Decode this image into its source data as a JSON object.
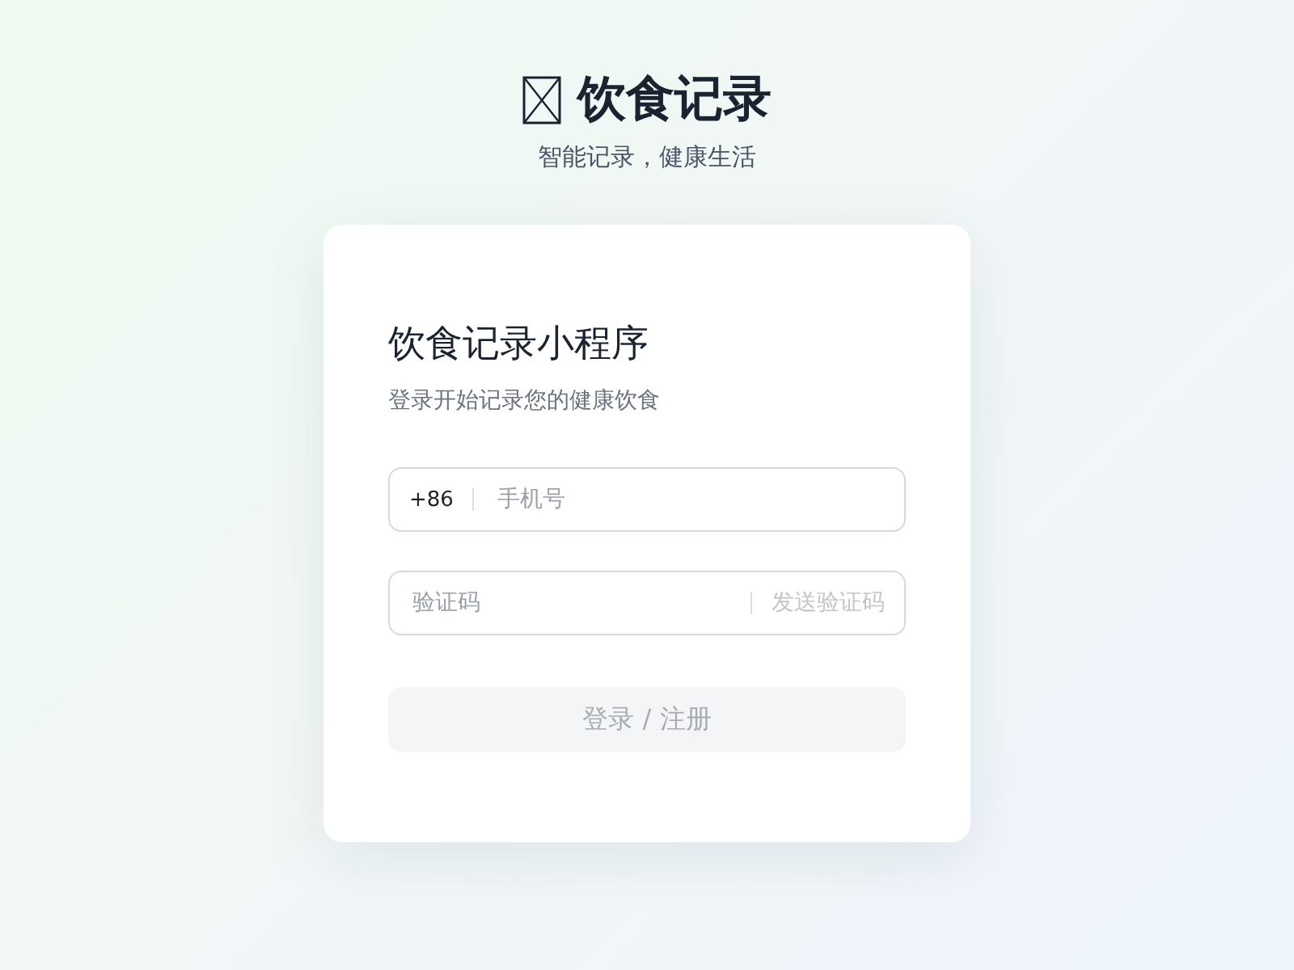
{
  "header": {
    "title": "饮食记录",
    "subtitle": "智能记录，健康生活"
  },
  "card": {
    "title": "饮食记录小程序",
    "subtitle": "登录开始记录您的健康饮食",
    "phone_field": {
      "prefix": "+86",
      "placeholder": "手机号"
    },
    "code_field": {
      "placeholder": "验证码",
      "send_button": {
        "label": "发送验证码",
        "disabled": true
      }
    },
    "submit_button": {
      "label": "登录 / 注册",
      "disabled": true
    }
  }
}
